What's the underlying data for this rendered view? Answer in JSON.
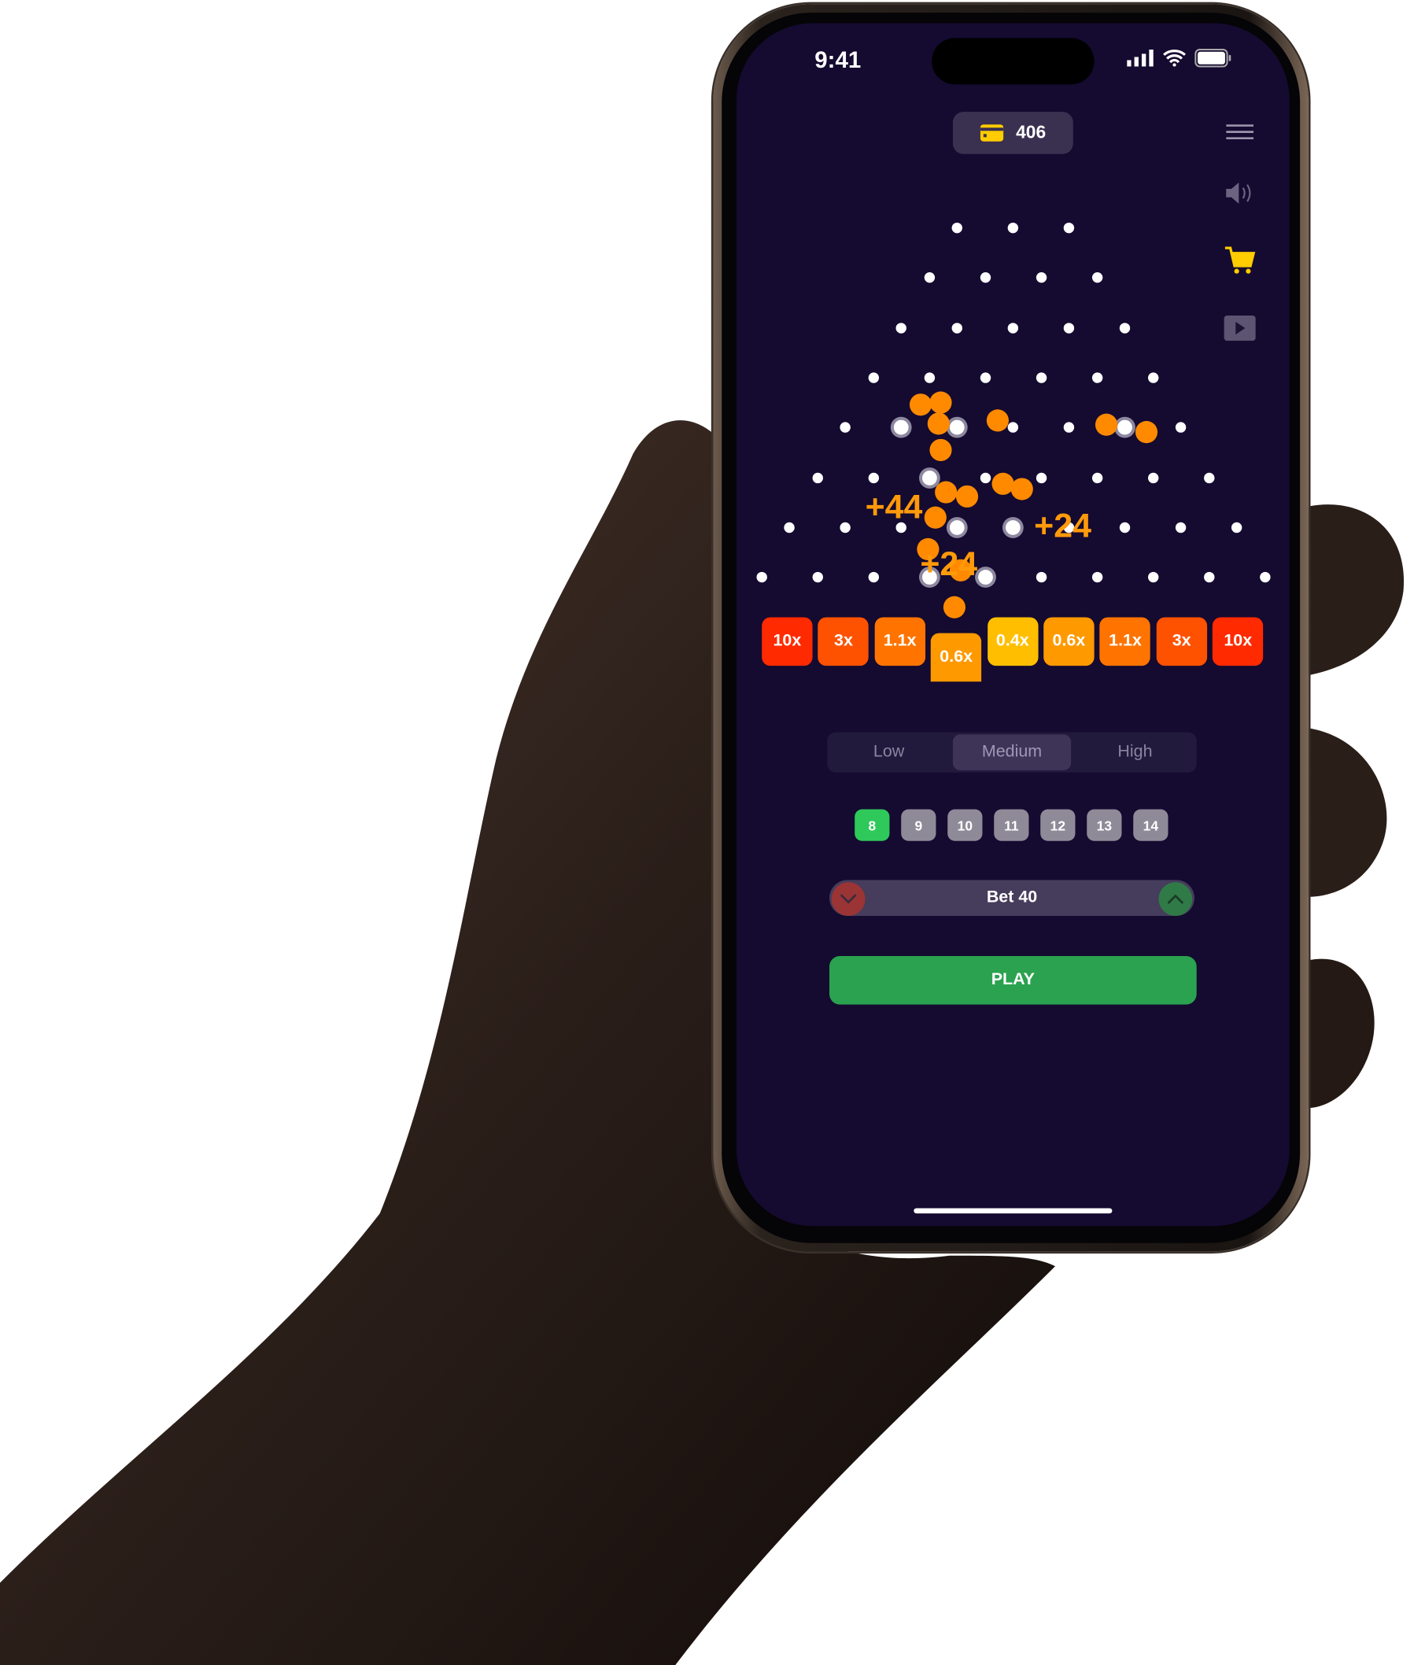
{
  "status_bar": {
    "time": "9:41",
    "icons": [
      "cellular-signal-icon",
      "wifi-icon",
      "battery-icon"
    ]
  },
  "header": {
    "balance": "406",
    "balance_icon": "wallet-icon",
    "menu_icon": "hamburger-menu-icon"
  },
  "side_buttons": [
    "speaker-icon",
    "cart-icon",
    "video-play-icon"
  ],
  "board": {
    "rows": 8,
    "gains": [
      "+44",
      "+24",
      "+24"
    ],
    "buckets": [
      {
        "label": "10x",
        "color": "#ff2a00"
      },
      {
        "label": "3x",
        "color": "#ff5200"
      },
      {
        "label": "1.1x",
        "color": "#ff7400"
      },
      {
        "label": "0.6x",
        "color": "#ff9900",
        "active": true
      },
      {
        "label": "0.4x",
        "color": "#ffbf00"
      },
      {
        "label": "0.6x",
        "color": "#ff9900"
      },
      {
        "label": "1.1x",
        "color": "#ff7400"
      },
      {
        "label": "3x",
        "color": "#ff5200"
      },
      {
        "label": "10x",
        "color": "#ff2a00"
      }
    ]
  },
  "risk": {
    "options": [
      "Low",
      "Medium",
      "High"
    ],
    "selected": "Medium"
  },
  "row_options": {
    "values": [
      "8",
      "9",
      "10",
      "11",
      "12",
      "13",
      "14"
    ],
    "selected": "8"
  },
  "bet": {
    "label": "Bet 40",
    "decrease_color": "#9b3434",
    "increase_color": "#2f7a46"
  },
  "play": {
    "label": "PLAY"
  },
  "colors": {
    "background": "#150a30",
    "ball": "#ff8a00",
    "accent_green": "#2aa24f",
    "balance_icon": "#ffcc00"
  }
}
